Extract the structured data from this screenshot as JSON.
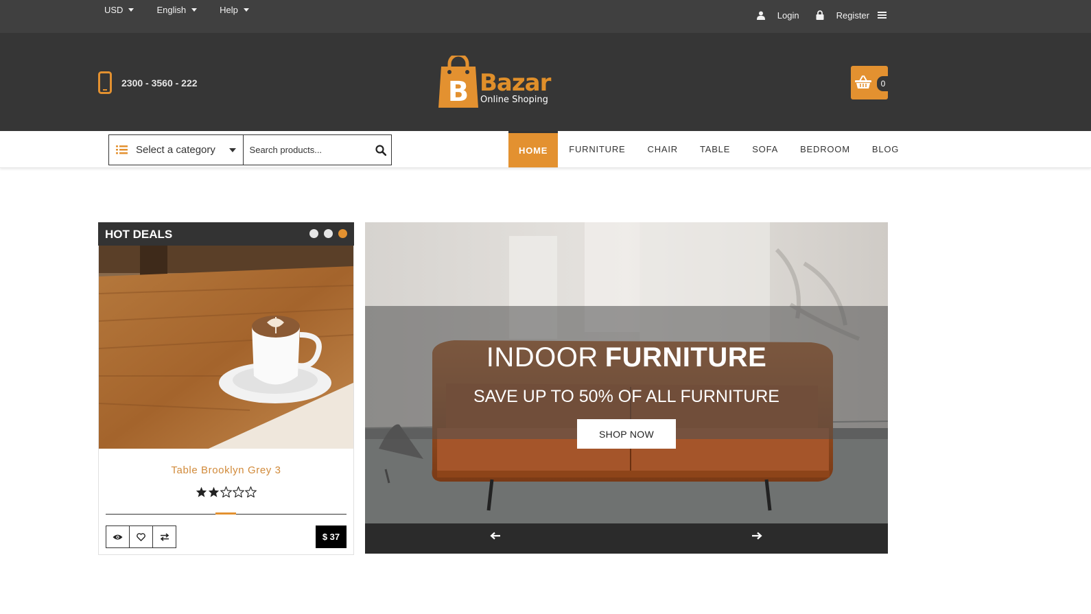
{
  "topbar": {
    "currency": "USD",
    "language": "English",
    "help": "Help",
    "login": "Login",
    "register": "Register"
  },
  "header": {
    "phone": "2300 - 3560 - 222",
    "logo_word": "Bazar",
    "logo_sub": "Online Shoping",
    "cart_count": "0"
  },
  "search": {
    "category_label": "Select a category",
    "placeholder": "Search products..."
  },
  "nav": {
    "items": [
      "HOME",
      "FURNITURE",
      "CHAIR",
      "TABLE",
      "SOFA",
      "BEDROOM",
      "BLOG"
    ]
  },
  "hot_deals": {
    "title": "HOT DEALS",
    "product_name": "Table Brooklyn Grey 3",
    "rating": 2,
    "rating_max": 5,
    "price": "$ 37"
  },
  "slider": {
    "title_light": "INDOOR",
    "title_bold": "FURNITURE",
    "subtitle": "SAVE UP TO 50% OF ALL FURNITURE",
    "button": "SHOP NOW"
  },
  "colors": {
    "accent": "#e39130",
    "topbar": "#404040",
    "header": "#363636"
  }
}
